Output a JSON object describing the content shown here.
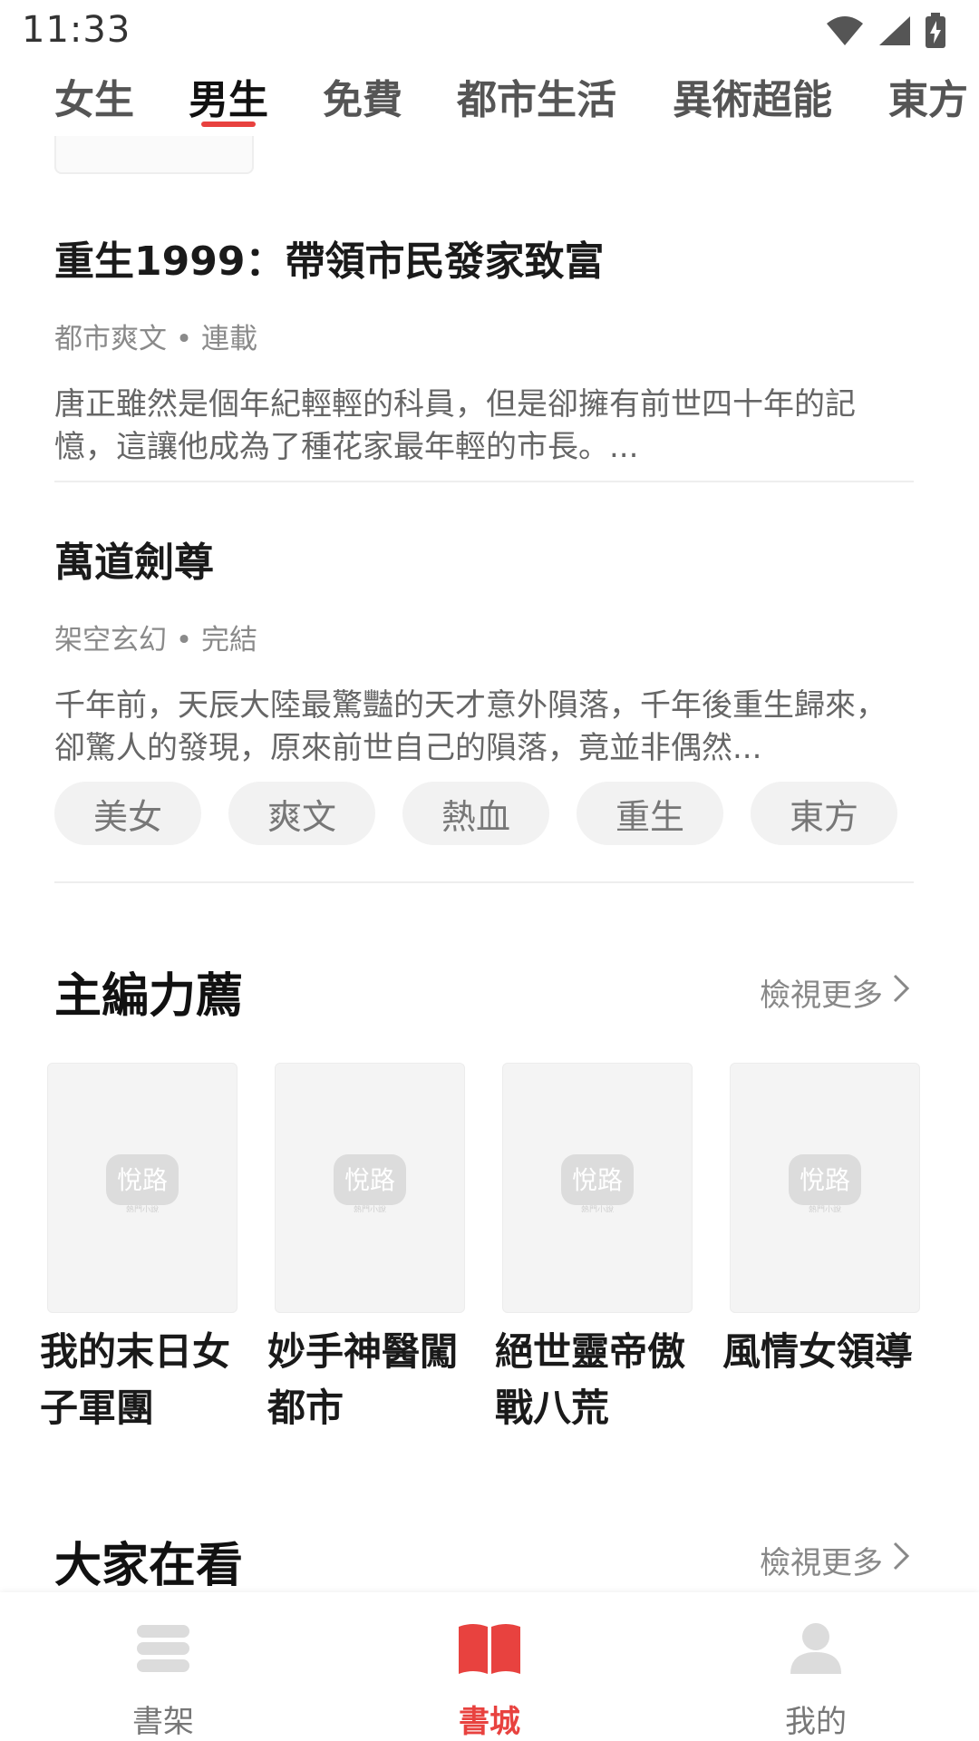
{
  "status_bar": {
    "time": "11:33"
  },
  "tabs": [
    {
      "label": "女生",
      "active": false
    },
    {
      "label": "男生",
      "active": true
    },
    {
      "label": "免費",
      "active": false
    },
    {
      "label": "都市生活",
      "active": false
    },
    {
      "label": "異術超能",
      "active": false
    },
    {
      "label": "東方",
      "active": false
    }
  ],
  "books": [
    {
      "title": "重生1999：帶領市民發家致富",
      "meta": "都市爽文 • 連載",
      "desc": "唐正雖然是個年紀輕輕的科員，但是卻擁有前世四十年的記憶，這讓他成為了種花家最年輕的市長。..."
    },
    {
      "title": "萬道劍尊",
      "meta": "架空玄幻 • 完結",
      "desc": "千年前，天辰大陸最驚豔的天才意外隕落，千年後重生歸來，卻驚人的發現，原來前世自己的隕落，竟並非偶然...",
      "tags": [
        "美女",
        "爽文",
        "熱血",
        "重生",
        "東方"
      ]
    }
  ],
  "editor_picks": {
    "title": "主編力薦",
    "more": "檢視更多",
    "cover_logo_text": "悅路",
    "cover_logo_sub": "熱門小說",
    "items": [
      {
        "title": "我的末日女子軍團"
      },
      {
        "title": "妙手神醫闖都市"
      },
      {
        "title": "絕世靈帝傲戰八荒"
      },
      {
        "title": "風情女領導"
      }
    ]
  },
  "everyone_watching": {
    "title": "大家在看",
    "more": "檢視更多"
  },
  "bottom_nav": [
    {
      "label": "書架",
      "icon": "bookshelf-icon",
      "active": false
    },
    {
      "label": "書城",
      "icon": "open-book-icon",
      "active": true
    },
    {
      "label": "我的",
      "icon": "user-icon",
      "active": false
    }
  ],
  "colors": {
    "accent": "#e8423f",
    "tag_bg": "#f2f2f2",
    "divider": "#eeeeee"
  }
}
